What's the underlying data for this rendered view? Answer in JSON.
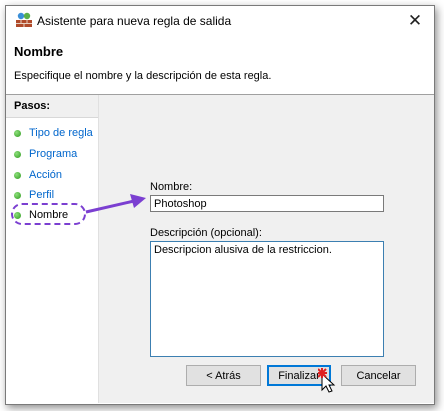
{
  "window": {
    "title": "Asistente para nueva regla de salida",
    "icon": "firewall-icon",
    "close_glyph": "✕"
  },
  "header": {
    "title": "Nombre",
    "description": "Especifique el nombre y la descripción de esta regla."
  },
  "steps": {
    "heading": "Pasos:",
    "items": [
      {
        "label": "Tipo de regla"
      },
      {
        "label": "Programa"
      },
      {
        "label": "Acción"
      },
      {
        "label": "Perfil"
      },
      {
        "label": "Nombre"
      }
    ],
    "current_index": 4
  },
  "form": {
    "name_label": "Nombre:",
    "name_value": "Photoshop",
    "description_label": "Descripción (opcional):",
    "description_value": "Descripcion alusiva de la restriccion."
  },
  "buttons": {
    "back": "< Atrás",
    "finish": "Finalizar",
    "cancel": "Cancelar"
  },
  "colors": {
    "accent": "#0078d7",
    "annotation": "#7b3fd1",
    "step_dot": "#2e9a1e",
    "step_link": "#0066cc"
  }
}
